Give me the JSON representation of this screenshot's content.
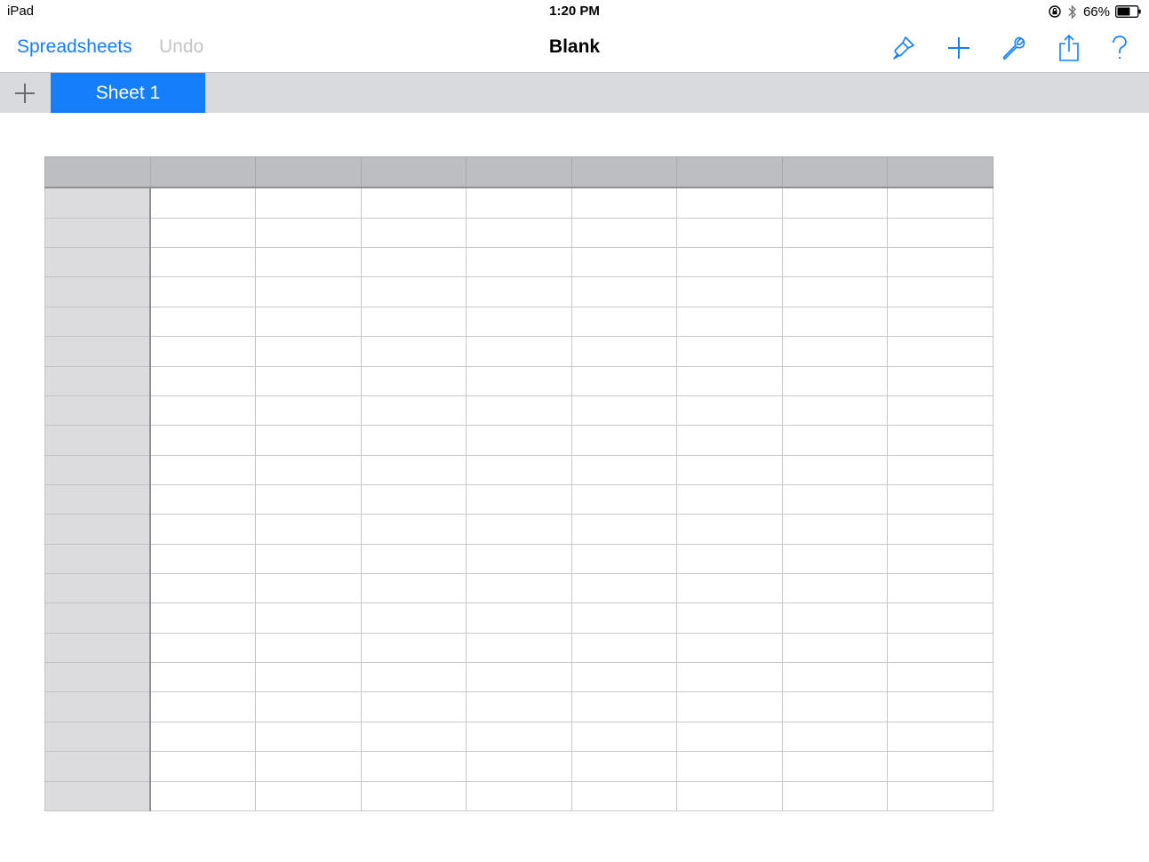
{
  "status_bar": {
    "device": "iPad",
    "time": "1:20 PM",
    "battery": "66%",
    "battery_level": 0.66,
    "icons": [
      "rotation-lock-icon",
      "bluetooth-icon",
      "battery-icon"
    ]
  },
  "toolbar": {
    "back_label": "Spreadsheets",
    "undo_label": "Undo",
    "title": "Blank",
    "icons": [
      "paintbrush-icon",
      "plus-icon",
      "wrench-icon",
      "share-icon",
      "help-icon"
    ]
  },
  "sheets": {
    "tabs": [
      {
        "label": "Sheet 1",
        "selected": true
      }
    ],
    "add_icon": "plus-icon"
  },
  "table": {
    "header_rows": 1,
    "header_columns": 1,
    "columns": 9,
    "rows": 22,
    "cells": []
  },
  "colors": {
    "accent": "#147efb",
    "disabled": "#c5c5c9",
    "tabbar_bg": "#d9dadd",
    "header_bg": "#bdbec1",
    "row_header_bg": "#dcdcde"
  }
}
